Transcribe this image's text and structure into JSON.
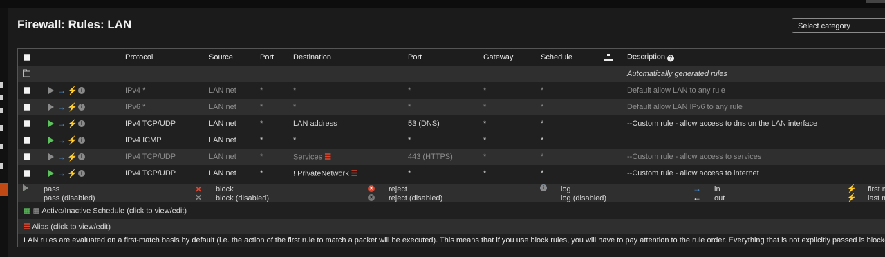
{
  "page": {
    "title": "Firewall: Rules: LAN"
  },
  "category_select": {
    "value": "Select category"
  },
  "table": {
    "headers": [
      "Protocol",
      "Source",
      "Port",
      "Destination",
      "Port",
      "Gateway",
      "Schedule",
      "Description"
    ],
    "group_row": "Automatically generated rules",
    "rows": [
      {
        "protocol": "IPv4 *",
        "source": "LAN net",
        "src_port": "*",
        "destination": "*",
        "dst_port": "*",
        "gateway": "*",
        "schedule": "*",
        "description": "Default allow LAN to any rule",
        "disabled": true
      },
      {
        "protocol": "IPv6 *",
        "source": "LAN net",
        "src_port": "*",
        "destination": "*",
        "dst_port": "*",
        "gateway": "*",
        "schedule": "*",
        "description": "Default allow LAN IPv6 to any rule",
        "disabled": true
      },
      {
        "protocol": "IPv4 TCP/UDP",
        "source": "LAN net",
        "src_port": "*",
        "destination": "LAN address",
        "dst_port": "53 (DNS)",
        "gateway": "*",
        "schedule": "*",
        "description": "--Custom rule - allow access to dns on the LAN interface",
        "disabled": false
      },
      {
        "protocol": "IPv4 ICMP",
        "source": "LAN net",
        "src_port": "*",
        "destination": "*",
        "dst_port": "*",
        "gateway": "*",
        "schedule": "*",
        "description": "",
        "disabled": false
      },
      {
        "protocol": "IPv4 TCP/UDP",
        "source": "LAN net",
        "src_port": "*",
        "destination": "Services",
        "dst_port": "443 (HTTPS)",
        "gateway": "*",
        "schedule": "*",
        "description": "--Custom rule - allow access to services",
        "disabled": true
      },
      {
        "protocol": "IPv4 TCP/UDP",
        "source": "LAN net",
        "src_port": "*",
        "destination": "! PrivateNetwork",
        "dst_port": "*",
        "gateway": "*",
        "schedule": "*",
        "description": "--Custom rule - allow access to internet",
        "disabled": false
      }
    ]
  },
  "legend": {
    "pass": "pass",
    "pass_disabled": "pass (disabled)",
    "block": "block",
    "block_disabled": "block (disabled)",
    "reject": "reject",
    "reject_disabled": "reject (disabled)",
    "log": "log",
    "log_disabled": "log (disabled)",
    "in": "in",
    "out": "out",
    "first_match": "first m",
    "last_match": "last m"
  },
  "schedule_note": "Active/Inactive Schedule (click to view/edit)",
  "alias_note": "Alias (click to view/edit)",
  "footer_note": "LAN rules are evaluated on a first-match basis by default (i.e. the action of the first rule to match a packet will be executed). This means that if you use block rules, you will have to pay attention to the rule order. Everything that is not explicitly passed is blocked by default.",
  "colors": {
    "accent": "#c14a14",
    "pass": "#5cc25c",
    "block": "#e0452d",
    "in": "#4a90d9",
    "bolt": "#f0a020"
  }
}
